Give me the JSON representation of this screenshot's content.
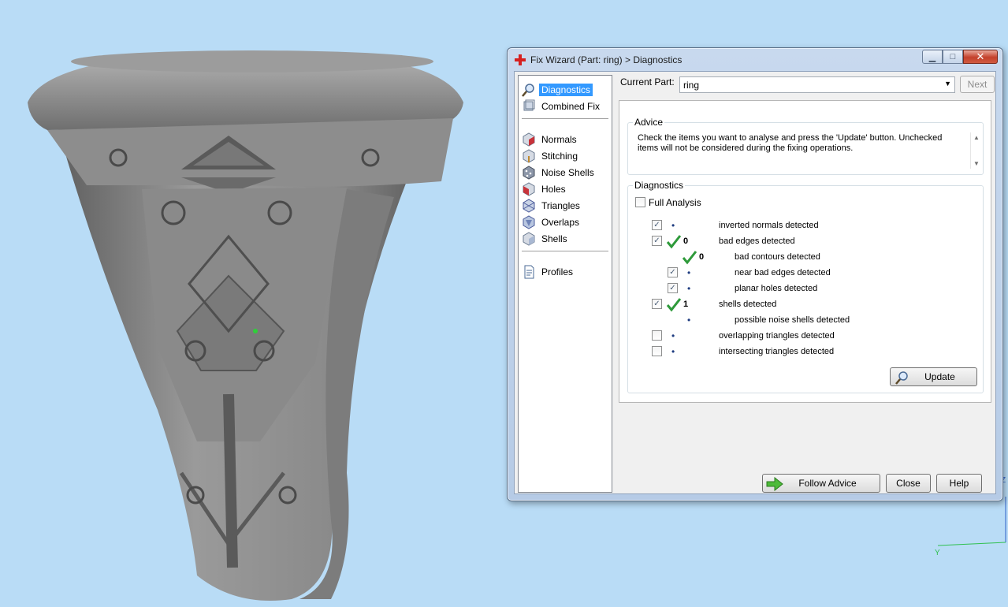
{
  "window": {
    "title": "Fix Wizard (Part: ring) > Diagnostics",
    "minimize": "▁",
    "maximize": "□",
    "close": "✕"
  },
  "nav": {
    "items": [
      {
        "label": "Diagnostics",
        "icon": "magnifier-icon",
        "selected": true
      },
      {
        "label": "Combined Fix",
        "icon": "combined-fix-icon"
      },
      {
        "label": "Normals",
        "icon": "normals-cube-icon"
      },
      {
        "label": "Stitching",
        "icon": "stitching-cube-icon"
      },
      {
        "label": "Noise Shells",
        "icon": "noise-shells-icon"
      },
      {
        "label": "Holes",
        "icon": "holes-cube-icon"
      },
      {
        "label": "Triangles",
        "icon": "triangles-icon"
      },
      {
        "label": "Overlaps",
        "icon": "overlaps-icon"
      },
      {
        "label": "Shells",
        "icon": "shells-cube-icon"
      },
      {
        "label": "Profiles",
        "icon": "document-icon"
      }
    ]
  },
  "current_part": {
    "label": "Current Part:",
    "value": "ring",
    "next_label": "Next"
  },
  "advice": {
    "title": "Advice",
    "text": "Check the items you want to analyse and press the 'Update' button. Unchecked items will not be considered during the fixing operations."
  },
  "diagnostics": {
    "title": "Diagnostics",
    "full_analysis_label": "Full Analysis",
    "rows": [
      {
        "label": "inverted normals detected",
        "checked": true,
        "status": "•",
        "count": ""
      },
      {
        "label": "bad edges detected",
        "checked": true,
        "status": "ok",
        "count": "0"
      },
      {
        "label": "bad contours detected",
        "checked": null,
        "status": "ok",
        "count": "0"
      },
      {
        "label": "near bad edges detected",
        "checked": true,
        "status": "•",
        "count": ""
      },
      {
        "label": "planar holes detected",
        "checked": true,
        "status": "•",
        "count": ""
      },
      {
        "label": "shells detected",
        "checked": true,
        "status": "ok",
        "count": "1"
      },
      {
        "label": "possible noise shells detected",
        "checked": null,
        "status": "•",
        "count": ""
      },
      {
        "label": "overlapping triangles detected",
        "checked": false,
        "status": "•",
        "count": ""
      },
      {
        "label": "intersecting triangles detected",
        "checked": false,
        "status": "•",
        "count": ""
      }
    ],
    "update_label": "Update"
  },
  "footer": {
    "follow_advice": "Follow Advice",
    "close": "Close",
    "help": "Help"
  },
  "axis": {
    "z": "Z",
    "y": "Y"
  },
  "colors": {
    "background": "#b9dcf6",
    "selection": "#3399ff",
    "tick": "#2e9a3a",
    "close_btn": "#c4412c"
  }
}
